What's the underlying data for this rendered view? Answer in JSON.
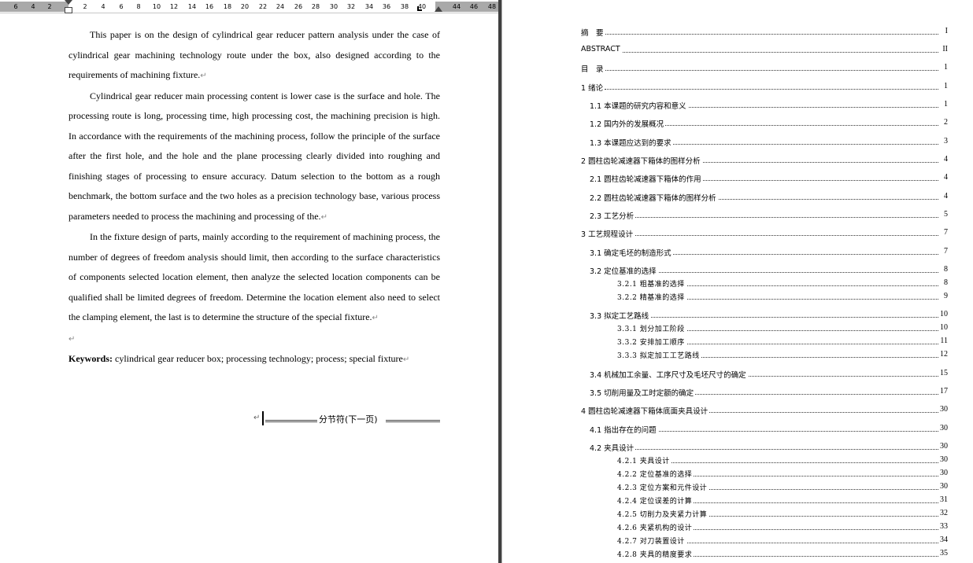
{
  "ruler": {
    "ticks": [
      "6",
      "4",
      "2",
      "2",
      "4",
      "6",
      "8",
      "10",
      "12",
      "14",
      "16",
      "18",
      "20",
      "22",
      "24",
      "26",
      "28",
      "30",
      "32",
      "34",
      "36",
      "38",
      "40",
      "44",
      "46",
      "48"
    ]
  },
  "abstract": {
    "paragraphs": [
      "This paper is on the design of cylindrical gear reducer pattern analysis under the case of cylindrical gear machining technology route under the box, also designed according to the requirements of machining fixture.",
      "Cylindrical gear reducer main processing content is lower case is the surface and hole. The processing route is long, processing time, high processing cost, the machining precision is high. In accordance with the requirements of the machining process, follow the principle of the surface after the first hole, and the hole and the plane processing clearly divided into roughing and finishing stages of processing to ensure accuracy. Datum selection to the bottom as a rough benchmark, the bottom surface and the two holes as a precision technology base, various process parameters needed to process the machining and processing of the.",
      "In the fixture design of parts, mainly according to the requirement of machining process, the number of degrees of freedom analysis should limit, then according to the surface characteristics of components selected location element, then analyze the selected location components can be qualified shall be limited degrees of freedom. Determine the location element also need to select the clamping element, the last is to determine the structure of the special fixture."
    ],
    "keywords_label": "Keywords:",
    "keywords_text": " cylindrical gear reducer box; processing technology; process; special fixture",
    "paragraph_mark": "↵",
    "section_break": "分节符(下一页)"
  },
  "toc": [
    {
      "text": "摘　要",
      "page": "I",
      "level": 0
    },
    {
      "text": "ABSTRACT",
      "page": "II",
      "level": 0
    },
    {
      "text": "目　录",
      "page": "1",
      "level": 0
    },
    {
      "text": "1  绪论",
      "page": "1",
      "level": 0
    },
    {
      "text": "1.1 本课题的研究内容和意义",
      "page": "1",
      "level": 1
    },
    {
      "text": "1.2 国内外的发展概况",
      "page": "2",
      "level": 1
    },
    {
      "text": "1.3 本课题应达到的要求",
      "page": "3",
      "level": 1
    },
    {
      "text": "2  圆柱齿轮减速器下箱体的图样分析",
      "page": "4",
      "level": 0
    },
    {
      "text": "2.1 圆柱齿轮减速器下箱体的作用",
      "page": "4",
      "level": 1
    },
    {
      "text": "2.2 圆柱齿轮减速器下箱体的图样分析",
      "page": "4",
      "level": 1
    },
    {
      "text": "2.3 工艺分析",
      "page": "5",
      "level": 1
    },
    {
      "text": "3  工艺规程设计",
      "page": "7",
      "level": 0
    },
    {
      "text": "3.1 确定毛坯的制造形式",
      "page": "7",
      "level": 1
    },
    {
      "text": "3.2 定位基准的选择",
      "page": "8",
      "level": 1
    },
    {
      "text": "3.2.1 粗基准的选择",
      "page": "8",
      "level": 2
    },
    {
      "text": "3.2.2 精基准的选择",
      "page": "9",
      "level": 2
    },
    {
      "text": "3.3 拟定工艺路线",
      "page": "10",
      "level": 1
    },
    {
      "text": "3.3.1 划分加工阶段",
      "page": "10",
      "level": 2
    },
    {
      "text": "3.3.2 安排加工顺序",
      "page": "11",
      "level": 2
    },
    {
      "text": "3.3.3 拟定加工工艺路线",
      "page": "12",
      "level": 2
    },
    {
      "text": "3.4 机械加工余量、工序尺寸及毛坯尺寸的确定",
      "page": "15",
      "level": 1
    },
    {
      "text": "3.5 切削用量及工时定额的确定",
      "page": "17",
      "level": 1
    },
    {
      "text": "4  圆柱齿轮减速器下箱体底面夹具设计",
      "page": "30",
      "level": 0
    },
    {
      "text": "4.1 指出存在的问题",
      "page": "30",
      "level": 1
    },
    {
      "text": "4.2 夹具设计",
      "page": "30",
      "level": 1
    },
    {
      "text": "4.2.1 夹具设计",
      "page": "30",
      "level": 2
    },
    {
      "text": "4.2.2 定位基准的选择",
      "page": "30",
      "level": 2
    },
    {
      "text": "4.2.3 定位方案和元件设计",
      "page": "30",
      "level": 2
    },
    {
      "text": "4.2.4 定位误差的计算",
      "page": "31",
      "level": 2
    },
    {
      "text": "4.2.5 切削力及夹紧力计算",
      "page": "32",
      "level": 2
    },
    {
      "text": "4.2.6 夹紧机构的设计",
      "page": "33",
      "level": 2
    },
    {
      "text": "4.2.7 对刀装置设计",
      "page": "34",
      "level": 2
    },
    {
      "text": "4.2.8 夹具的精度要求",
      "page": "35",
      "level": 2
    }
  ]
}
